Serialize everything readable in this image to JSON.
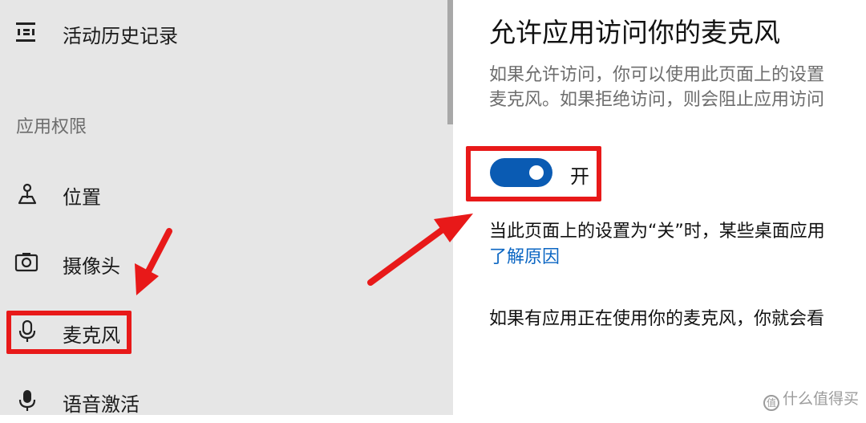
{
  "sidebar": {
    "activity_history": "活动历史记录",
    "section_title": "应用权限",
    "items": [
      {
        "label": "位置",
        "icon": "location-icon"
      },
      {
        "label": "摄像头",
        "icon": "camera-icon"
      },
      {
        "label": "麦克风",
        "icon": "microphone-icon"
      },
      {
        "label": "语音激活",
        "icon": "voice-activation-icon"
      }
    ]
  },
  "main": {
    "title": "允许应用访问你的麦克风",
    "description_line1": "如果允许访问，你可以使用此页面上的设置",
    "description_line2": "麦克风。如果拒绝访问，则会阻止应用访问",
    "toggle": {
      "state": "on",
      "label": "开"
    },
    "notice": "当此页面上的设置为“关”时，某些桌面应用",
    "learn_more": "了解原因",
    "note": "如果有应用正在使用你的麦克风，你就会看"
  },
  "watermark": {
    "text": "什么值得买",
    "icon_char": "值"
  },
  "colors": {
    "annotation": "#e81919",
    "toggle_on": "#0a5bb3",
    "link": "#0b66c3"
  }
}
